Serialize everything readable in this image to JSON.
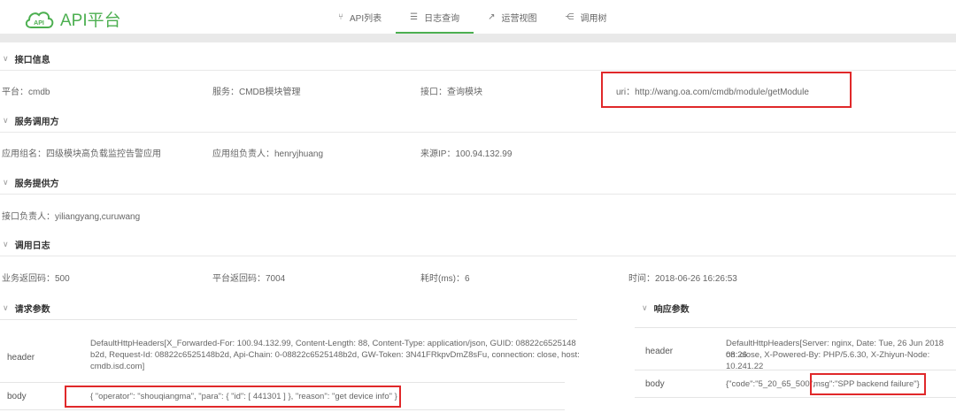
{
  "header": {
    "app_name": "API平台",
    "logo_badge": "API",
    "nav": [
      {
        "icon": "api-list-icon",
        "glyph": "⑂",
        "label": "API列表",
        "active": false
      },
      {
        "icon": "log-list-icon",
        "glyph": "☰",
        "label": "日志查询",
        "active": true
      },
      {
        "icon": "chart-icon",
        "glyph": "↗",
        "label": "运营视图",
        "active": false
      },
      {
        "icon": "tree-icon",
        "glyph": "⋲",
        "label": "调用树",
        "active": false
      }
    ]
  },
  "interface_info": {
    "title": "接口信息",
    "platform": "平台：cmdb",
    "service": "服务：CMDB模块管理",
    "interface": "接口：查询模块",
    "uri": "uri：http://wang.oa.com/cmdb/module/getModule"
  },
  "caller": {
    "title": "服务调用方",
    "app_group": "应用组名：四级模块高负载监控告警应用",
    "owner": "应用组负责人：henryjhuang",
    "source_ip": "来源IP：100.94.132.99"
  },
  "provider": {
    "title": "服务提供方",
    "owner": "接口负责人：yiliangyang,curuwang"
  },
  "call_log": {
    "title": "调用日志",
    "biz_code": "业务返回码：500",
    "platform_code": "平台返回码：7004",
    "elapsed": "耗时(ms)：6",
    "time": "时间：2018-06-26 16:26:53"
  },
  "request": {
    "title": "请求参数",
    "header_label": "header",
    "header_value_1": "DefaultHttpHeaders[X_Forwarded-For: 100.94.132.99, Content-Length: 88, Content-Type: application/json, GUID: 08822c6525148",
    "header_value_2": "b2d, Request-Id: 08822c6525148b2d, Api-Chain: 0-08822c6525148b2d, GW-Token: 3N41FRkpvDmZ8sFu, connection: close, host:",
    "header_value_3": "cmdb.isd.com]",
    "body_label": "body",
    "body_value": "{ \"operator\": \"shouqiangma\", \"para\": { \"id\": [ 441301 ] }, \"reason\": \"get device info\" }"
  },
  "response": {
    "title": "响应参数",
    "header_label": "header",
    "header_value_1": "DefaultHttpHeaders[Server: nginx, Date: Tue, 26 Jun 2018 08:26",
    "header_value_2": "on: close, X-Powered-By: PHP/5.6.30, X-Zhiyun-Node: 10.241.22",
    "body_label": "body",
    "body_code": "{\"code\":\"5_20_65_500\",",
    "body_msg": "msg\":\"SPP backend failure\"}"
  },
  "colors": {
    "brand": "#4caf50",
    "highlight": "#e0282a"
  }
}
